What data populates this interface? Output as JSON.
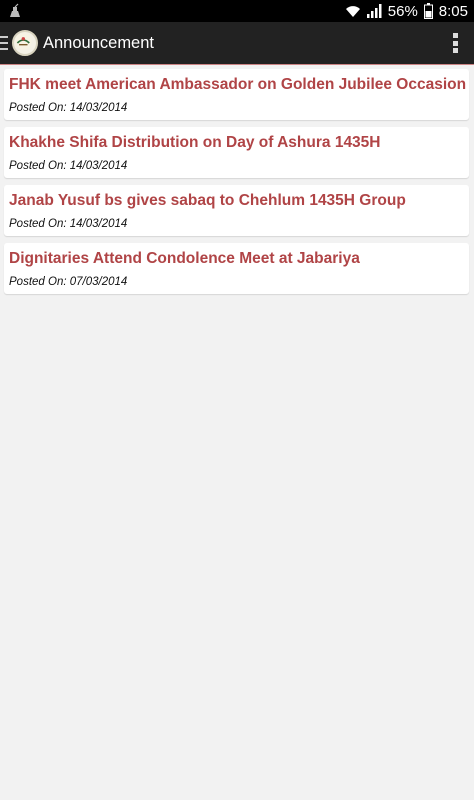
{
  "status_bar": {
    "notification_icon": "debug-bug-icon",
    "wifi_icon": "wifi-icon",
    "signal_icon": "cell-signal-icon",
    "battery_percent": "56%",
    "battery_icon": "battery-icon",
    "time": "8:05"
  },
  "action_bar": {
    "menu_icon": "hamburger-icon",
    "logo": "app-logo",
    "title": "Announcement",
    "overflow_icon": "overflow-menu-icon"
  },
  "announcements": [
    {
      "title": "FHK meet American Ambassador on Golden Jubilee Occasion",
      "date_text": "Posted On: 14/03/2014"
    },
    {
      "title": "Khakhe Shifa Distribution on Day of Ashura 1435H",
      "date_text": "Posted On: 14/03/2014"
    },
    {
      "title": "Janab Yusuf bs gives sabaq to Chehlum 1435H Group",
      "date_text": "Posted On: 14/03/2014"
    },
    {
      "title": "Dignitaries Attend Condolence Meet at Jabariya",
      "date_text": "Posted On: 07/03/2014"
    }
  ],
  "colors": {
    "title_red": "#b04446",
    "action_bar": "#222222",
    "background": "#f2f2f2"
  }
}
